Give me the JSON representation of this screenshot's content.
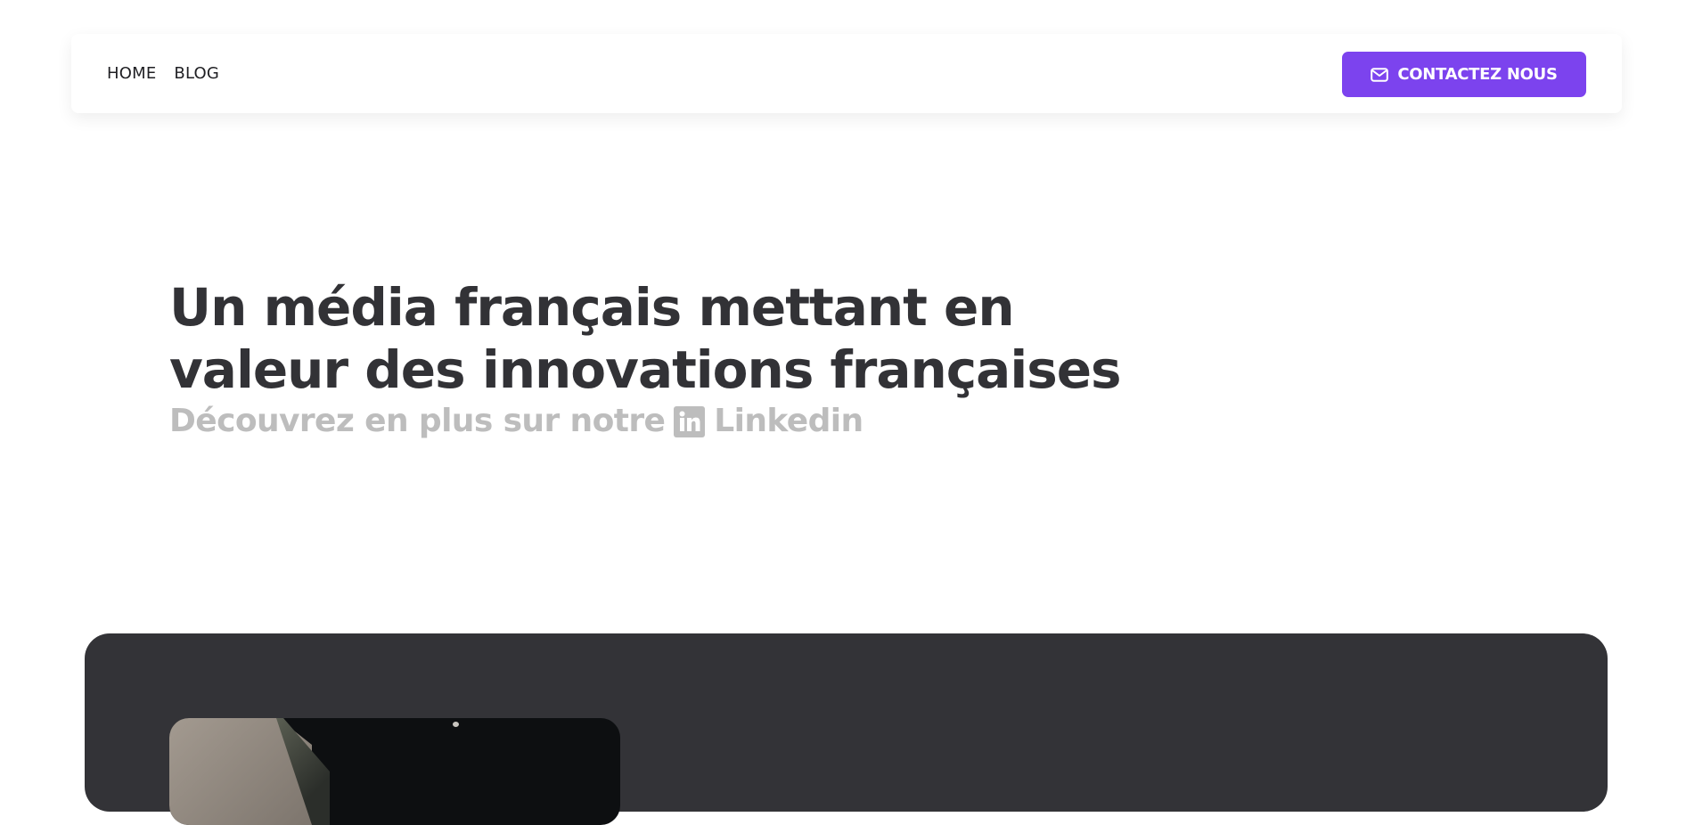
{
  "nav": {
    "links": [
      "HOME",
      "BLOG"
    ],
    "cta_label": "CONTACTEZ NOUS",
    "cta_icon": "mail-icon",
    "cta_color": "#7c43ee"
  },
  "hero": {
    "title_line1": "Un média français mettant en",
    "title_line2": "valeur des innovations françaises",
    "subtitle_prefix": "Découvrez en plus sur notre",
    "subtitle_icon": "linkedin-icon",
    "subtitle_link": "Linkedin"
  },
  "featured": {
    "background_color": "#333337"
  }
}
